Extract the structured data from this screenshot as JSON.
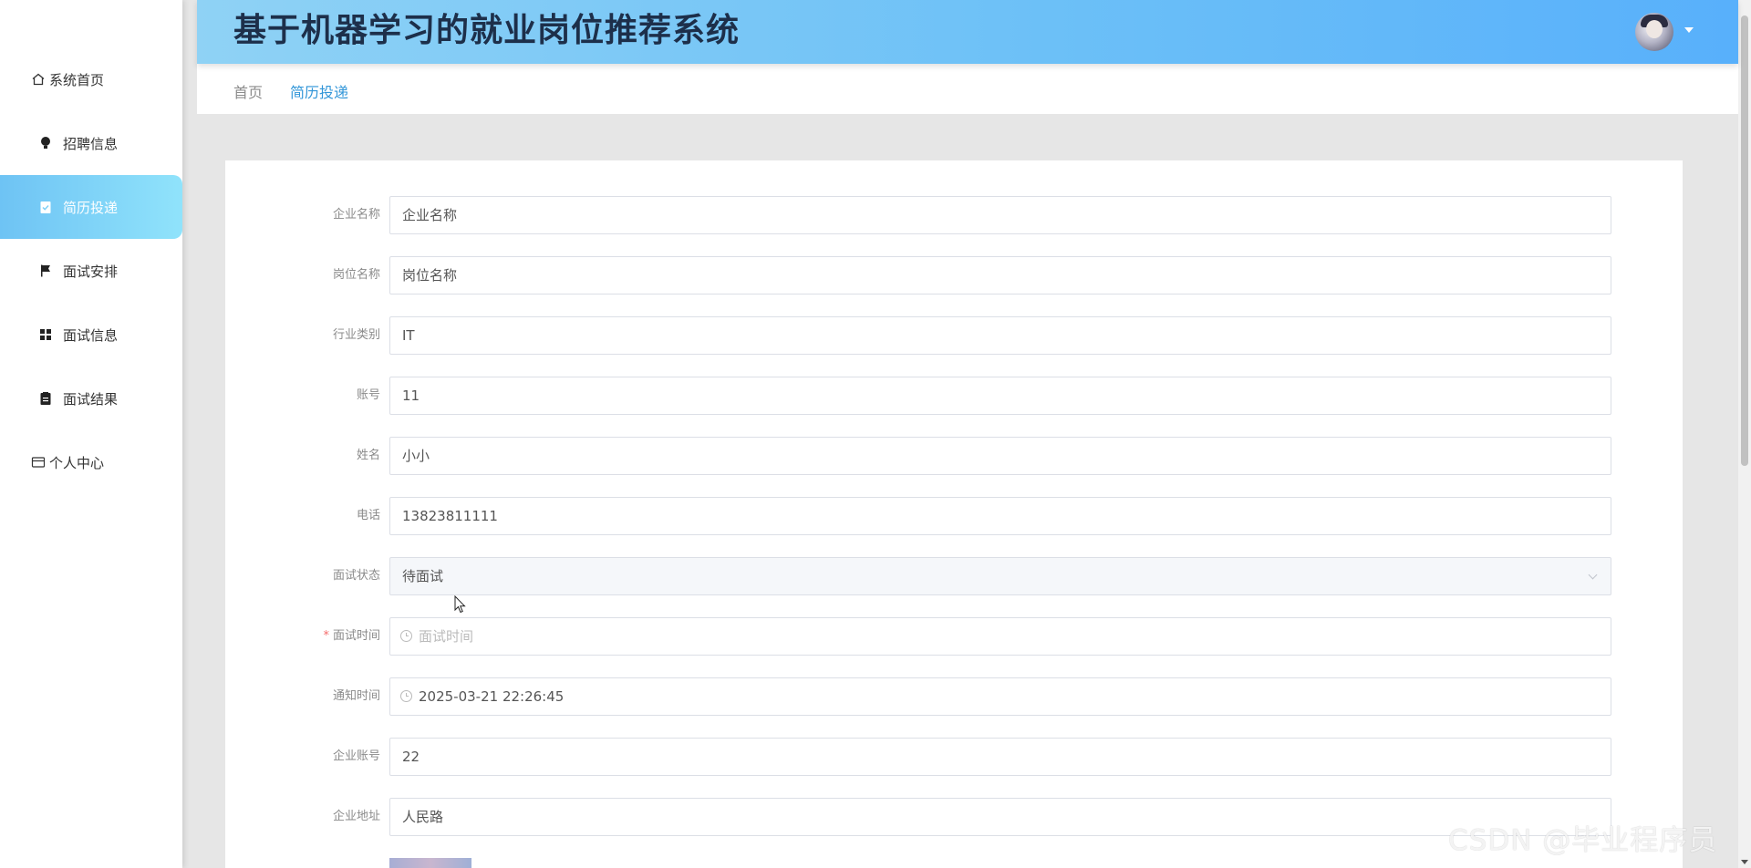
{
  "app": {
    "title": "基于机器学习的就业岗位推荐系统"
  },
  "sidebar": {
    "items": [
      {
        "label": "系统首页",
        "icon": "home-icon",
        "active": false
      },
      {
        "label": "招聘信息",
        "icon": "bulb-icon",
        "active": false
      },
      {
        "label": "简历投递",
        "icon": "clipboard-check-icon",
        "active": true
      },
      {
        "label": "面试安排",
        "icon": "flag-icon",
        "active": false
      },
      {
        "label": "面试信息",
        "icon": "grid-icon",
        "active": false
      },
      {
        "label": "面试结果",
        "icon": "clipboard-icon",
        "active": false
      },
      {
        "label": "个人中心",
        "icon": "wallet-icon",
        "active": false
      }
    ]
  },
  "breadcrumb": {
    "home": "首页",
    "current": "简历投递"
  },
  "form": {
    "company_name": {
      "label": "企业名称",
      "value": "企业名称"
    },
    "position_name": {
      "label": "岗位名称",
      "value": "岗位名称"
    },
    "industry": {
      "label": "行业类别",
      "value": "IT"
    },
    "account": {
      "label": "账号",
      "value": "11"
    },
    "name": {
      "label": "姓名",
      "value": "小小"
    },
    "phone": {
      "label": "电话",
      "value": "13823811111"
    },
    "interview_status": {
      "label": "面试状态",
      "value": "待面试"
    },
    "interview_time": {
      "label": "面试时间",
      "placeholder": "面试时间",
      "required": "*"
    },
    "notify_time": {
      "label": "通知时间",
      "value": "2025-03-21 22:26:45"
    },
    "company_account": {
      "label": "企业账号",
      "value": "22"
    },
    "company_address": {
      "label": "企业地址",
      "value": "人民路"
    }
  },
  "watermark": "CSDN @毕业程序员",
  "colors": {
    "accent": "#3296d8",
    "active_nav": "#6ec3f4",
    "required": "#f56c6c"
  }
}
